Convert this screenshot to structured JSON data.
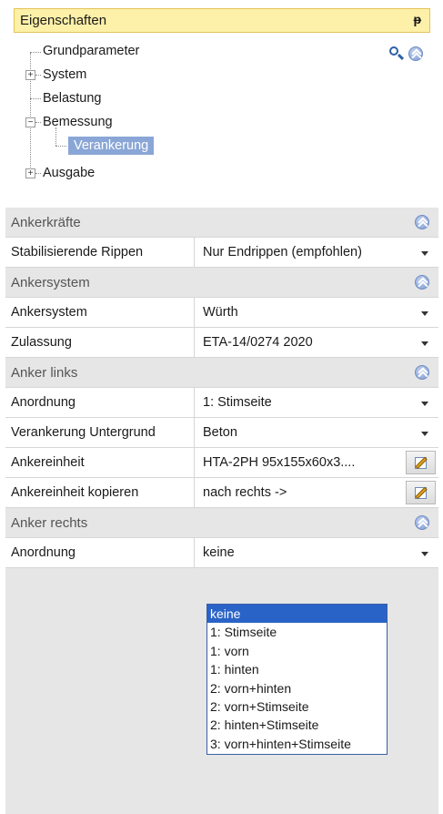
{
  "panel": {
    "title": "Eigenschaften",
    "pin_glyph": "ᵽ"
  },
  "tree": {
    "items": [
      {
        "label": "Grundparameter"
      },
      {
        "label": "System",
        "expander": "+"
      },
      {
        "label": "Belastung"
      },
      {
        "label": "Bemessung",
        "expander": "−"
      },
      {
        "label": "Verankerung"
      },
      {
        "label": "Ausgabe",
        "expander": "+"
      }
    ],
    "icons": [
      "search-icon",
      "collapse-all-icon"
    ]
  },
  "grid": {
    "categories": {
      "ankerkraefte": "Ankerkräfte",
      "ankersystem": "Ankersystem",
      "anker_links": "Anker links",
      "anker_rechts": "Anker rechts"
    },
    "rows": {
      "stabilisierende_rippen": {
        "name": "Stabilisierende Rippen",
        "value": "Nur Endrippen (empfohlen)"
      },
      "ankersystem": {
        "name": "Ankersystem",
        "value": "Würth"
      },
      "zulassung": {
        "name": "Zulassung",
        "value": "ETA-14/0274 2020"
      },
      "anordnung_links": {
        "name": "Anordnung",
        "value": "1: Stimseite"
      },
      "verankerung_untergrund": {
        "name": "Verankerung Untergrund",
        "value": "Beton"
      },
      "ankereinheit": {
        "name": "Ankereinheit",
        "value": "HTA-2PH 95x155x60x3...."
      },
      "ankereinheit_kopieren": {
        "name": "Ankereinheit kopieren",
        "value": "nach rechts ->"
      },
      "anordnung_rechts": {
        "name": "Anordnung",
        "value": "keine"
      }
    }
  },
  "dropdown": {
    "options": [
      "keine",
      "1: Stimseite",
      "1: vorn",
      "1: hinten",
      "2: vorn+hinten",
      "2: vorn+Stimseite",
      "2: hinten+Stimseite",
      "3: vorn+hinten+Stimseite"
    ],
    "selected": "keine"
  },
  "colors": {
    "title_bg": "#fdf0a8",
    "tree_selection": "#8aa6d6",
    "category_bg": "#e6e6e6",
    "dropdown_selection": "#2a63c7"
  }
}
